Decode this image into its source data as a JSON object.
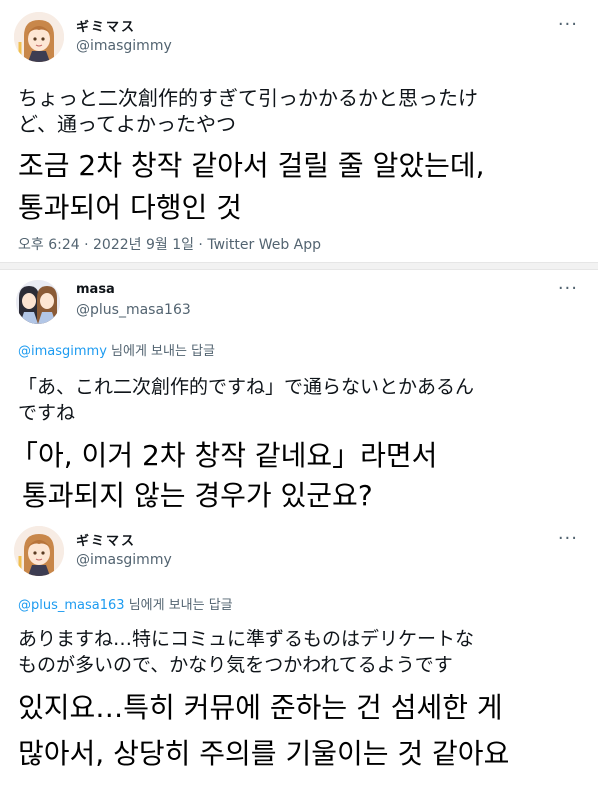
{
  "tweets": [
    {
      "display_name": "ギミマス",
      "handle": "@imasgimmy",
      "more": "···",
      "text_jp": "ちょっと二次創作的すぎて引っかかるかと思ったけど、通ってよかったやつ",
      "text_jp_line1": "ちょっと二次創作的すぎて引っかかるかと思ったけ",
      "text_jp_line2": "ど、通ってよかったやつ",
      "translation_line1": "조금 2차 창작 같아서 걸릴 줄 알았는데,",
      "translation_line2": "통과되어 다행인 것",
      "timestamp": "오후 6:24 · 2022년 9월 1일 · Twitter Web App"
    },
    {
      "display_name": "masa",
      "handle": "@plus_masa163",
      "more": "···",
      "reply_to_mention": "@imasgimmy",
      "reply_to_suffix": " 님에게 보내는 답글",
      "text_jp_line1": "「あ、これ二次創作的ですね」で通らないとかあるん",
      "text_jp_line2": "ですね",
      "translation_line1": "「아, 이거 2차 창작 같네요」라면서",
      "translation_line2": "통과되지 않는 경우가 있군요?"
    },
    {
      "display_name": "ギミマス",
      "handle": "@imasgimmy",
      "more": "···",
      "reply_to_mention": "@plus_masa163",
      "reply_to_suffix": " 님에게 보내는 답글",
      "text_jp_line1": "ありますね…特にコミュに準ずるものはデリケートな",
      "text_jp_line2": "ものが多いので、かなり気をつかわれてるようです",
      "translation_line1": "있지요…특히 커뮤에 준하는 건 섬세한 게",
      "translation_line2": "많아서, 상당히 주의를 기울이는 것 같아요"
    }
  ],
  "colors": {
    "handle_gray": "#536471",
    "link_blue": "#1d9bf0",
    "text": "#0f1419"
  }
}
